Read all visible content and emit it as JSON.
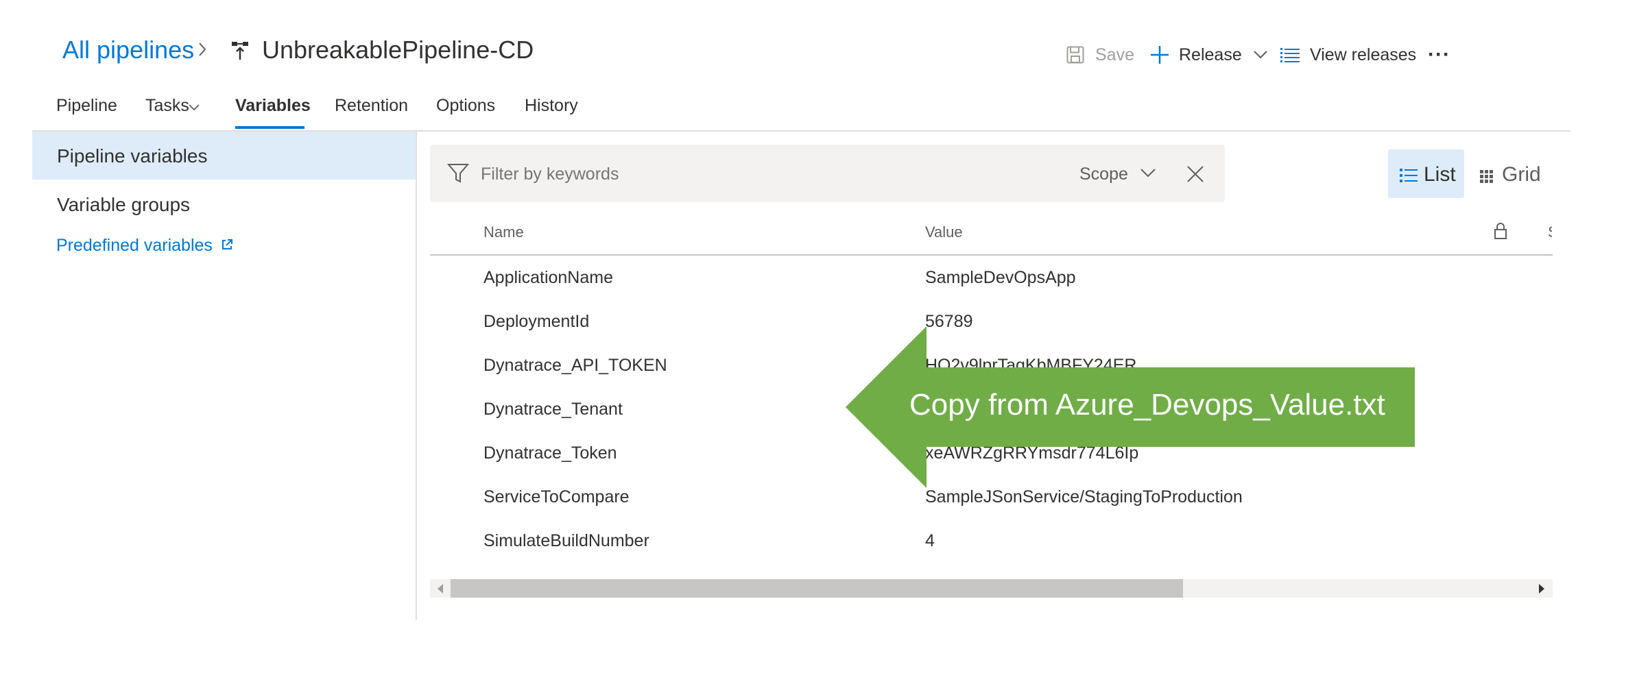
{
  "header": {
    "breadcrumb_root": "All pipelines",
    "pipeline_name": "UnbreakablePipeline-CD",
    "commands": {
      "save": "Save",
      "release": "Release",
      "view_releases": "View releases",
      "more": "···"
    }
  },
  "tabs": [
    {
      "label": "Pipeline"
    },
    {
      "label": "Tasks"
    },
    {
      "label": "Variables"
    },
    {
      "label": "Retention"
    },
    {
      "label": "Options"
    },
    {
      "label": "History"
    }
  ],
  "sidebar": {
    "items": [
      {
        "label": "Pipeline variables"
      },
      {
        "label": "Variable groups"
      }
    ],
    "link": "Predefined variables"
  },
  "filter": {
    "placeholder": "Filter by keywords",
    "scope_label": "Scope"
  },
  "view_toggle": {
    "list": "List",
    "grid": "Grid"
  },
  "table": {
    "columns": [
      "Name",
      "Value"
    ],
    "rows": [
      {
        "name": "ApplicationName",
        "value": "SampleDevOpsApp"
      },
      {
        "name": "DeploymentId",
        "value": "56789"
      },
      {
        "name": "Dynatrace_API_TOKEN",
        "value": "HO2v9lprTagKbMBFY24ER"
      },
      {
        "name": "Dynatrace_Tenant",
        "value": ""
      },
      {
        "name": "Dynatrace_Token",
        "value": "xeAWRZgRRYmsdr774L6Ip"
      },
      {
        "name": "ServiceToCompare",
        "value": "SampleJSonService/StagingToProduction"
      },
      {
        "name": "SimulateBuildNumber",
        "value": "4"
      }
    ]
  },
  "callout": {
    "text": "Copy from Azure_Devops_Value.txt",
    "color": "#70ad47"
  },
  "colors": {
    "accent": "#0078d4",
    "selected_bg": "#deecf9"
  }
}
